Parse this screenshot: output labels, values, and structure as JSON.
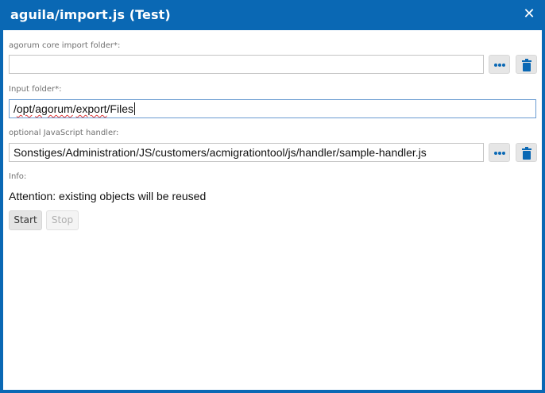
{
  "window": {
    "title": "aguila/import.js (Test)",
    "close_icon": "close-icon"
  },
  "form": {
    "core_folder": {
      "label": "agorum core import folder*:",
      "value": ""
    },
    "input_folder": {
      "label": "Input folder*:",
      "value_parts": [
        "/",
        "opt",
        "/",
        "agorum",
        "/",
        "export",
        "/Files"
      ]
    },
    "js_handler": {
      "label": "optional JavaScript handler:",
      "value": "Sonstiges/Administration/JS/customers/acmigrationtool/js/handler/sample-handler.js"
    },
    "info": {
      "label": "Info:",
      "text": "Attention: existing objects will be reused"
    }
  },
  "buttons": {
    "start": "Start",
    "stop": "Stop"
  },
  "icons": {
    "browse": "ellipsis-icon",
    "delete": "trash-icon"
  },
  "colors": {
    "accent": "#0a68b4",
    "field_border": "#c4c4c4",
    "spell_error": "#e03a3a"
  }
}
